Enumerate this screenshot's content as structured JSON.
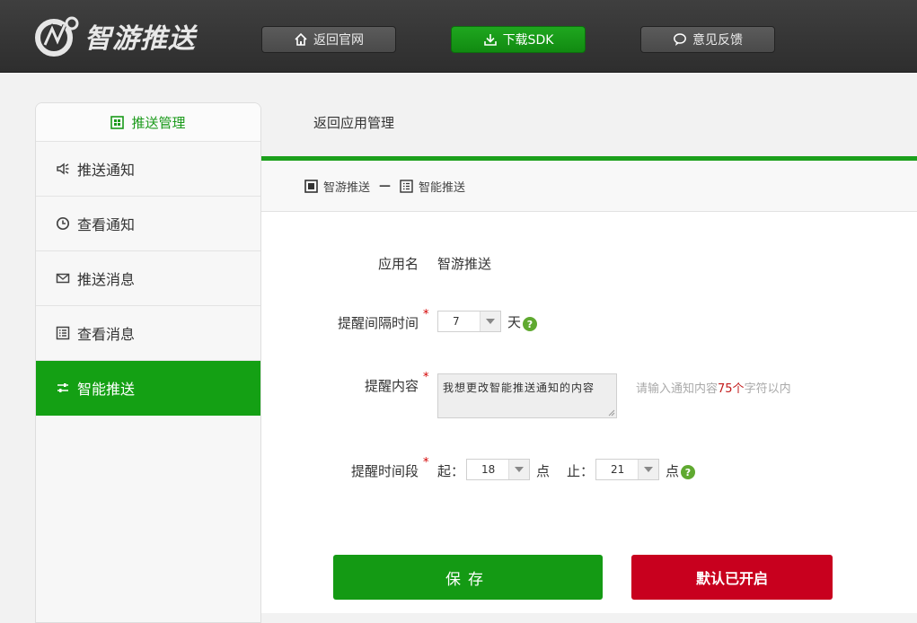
{
  "header": {
    "logo_text": "智游推送",
    "buttons": [
      {
        "label": "返回官网",
        "icon": "home-icon"
      },
      {
        "label": "下载SDK",
        "icon": "download-icon"
      },
      {
        "label": "意见反馈",
        "icon": "chat-bubble-icon"
      }
    ]
  },
  "sidebar": {
    "title": "推送管理",
    "items": [
      {
        "label": "推送通知",
        "icon": "speaker-icon"
      },
      {
        "label": "查看通知",
        "icon": "clock-icon"
      },
      {
        "label": "推送消息",
        "icon": "envelope-icon"
      },
      {
        "label": "查看消息",
        "icon": "list-icon"
      },
      {
        "label": "智能推送",
        "icon": "sliders-icon",
        "active": true
      }
    ]
  },
  "main": {
    "back_link": "返回应用管理",
    "breadcrumb": [
      "智游推送",
      "—",
      "智能推送"
    ],
    "form": {
      "app_name_label": "应用名",
      "app_name_value": "智游推送",
      "interval_label": "提醒间隔时间",
      "interval_value": "7",
      "interval_unit": "天",
      "content_label": "提醒内容",
      "content_value": "我想更改智能推送通知的内容",
      "content_hint_pre": "请输入通知内容",
      "content_hint_num": "75个",
      "content_hint_post": "字符以内",
      "period_label": "提醒时间段",
      "start_label": "起：",
      "start_value": "18",
      "start_unit": "点",
      "end_label": "止：",
      "end_value": "21",
      "end_unit": "点",
      "required_mark": "*",
      "help_mark": "?"
    },
    "save_label": "保存",
    "default_label": "默认已开启"
  },
  "colors": {
    "accent": "#14a014",
    "danger": "#c8001e",
    "header": "#353535"
  }
}
